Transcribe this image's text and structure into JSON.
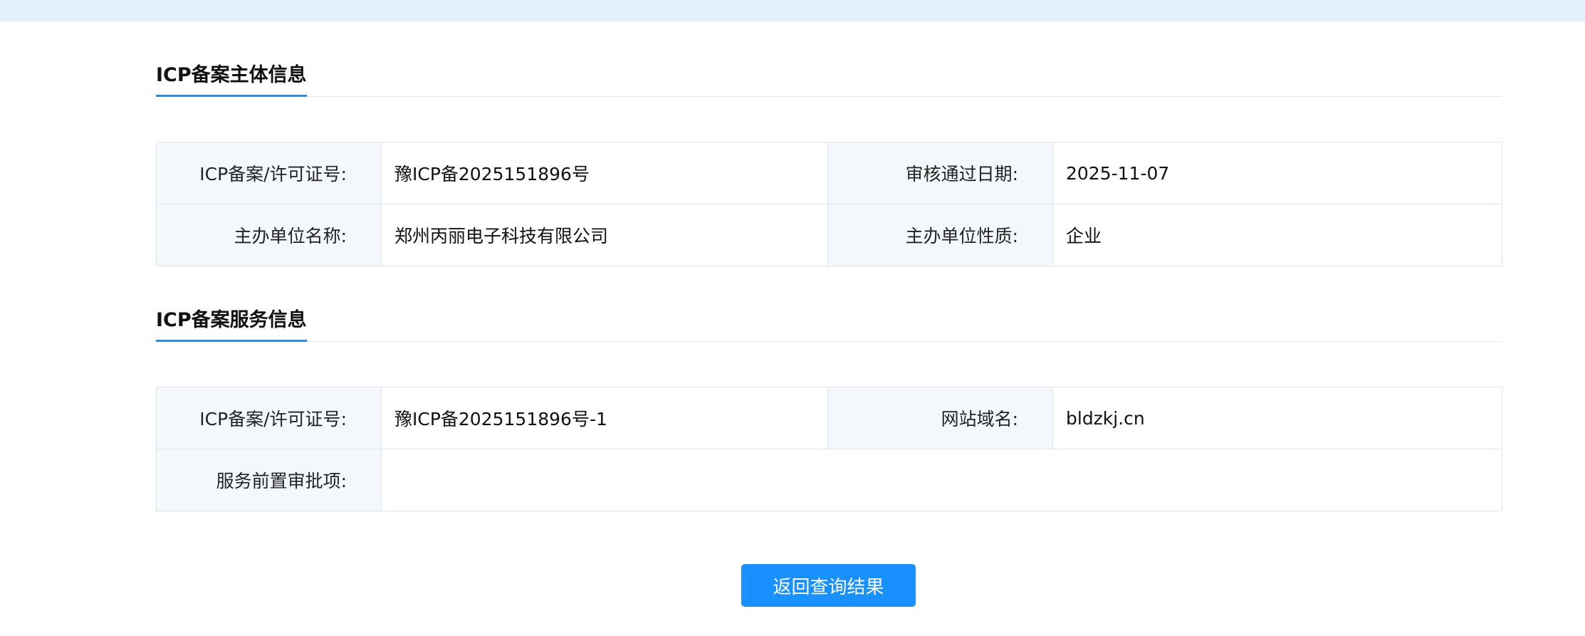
{
  "subject_section": {
    "title": "ICP备案主体信息",
    "rows": [
      {
        "label_left": "ICP备案/许可证号:",
        "value_left": "豫ICP备2025151896号",
        "label_right": "审核通过日期:",
        "value_right": "2025-11-07"
      },
      {
        "label_left": "主办单位名称:",
        "value_left": "郑州丙丽电子科技有限公司",
        "label_right": "主办单位性质:",
        "value_right": "企业"
      }
    ]
  },
  "service_section": {
    "title": "ICP备案服务信息",
    "rows": [
      {
        "label_left": "ICP备案/许可证号:",
        "value_left": "豫ICP备2025151896号-1",
        "label_right": "网站域名:",
        "value_right": "bldzkj.cn"
      },
      {
        "label_left": "服务前置审批项:",
        "value_left": ""
      }
    ]
  },
  "actions": {
    "back_label": "返回查询结果"
  },
  "colors": {
    "accent": "#1890ff",
    "top_bar": "#e5f1fc",
    "label_bg": "#f4f8fc",
    "border": "#dbe6f2"
  }
}
